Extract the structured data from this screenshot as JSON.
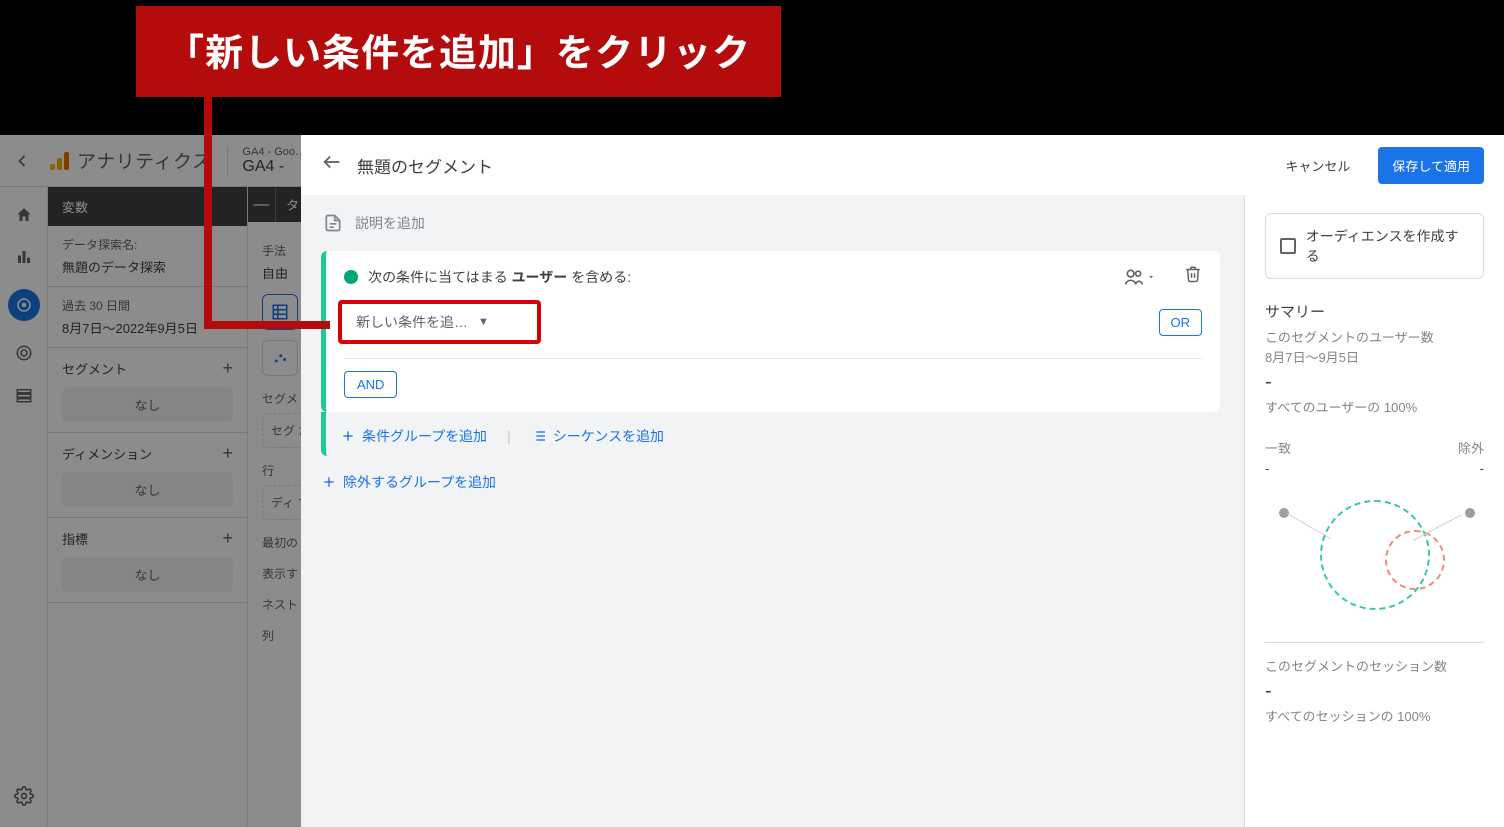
{
  "callout": "「新しい条件を追加」をクリック",
  "brand": "アナリティクス",
  "breadcrumb": {
    "l1": "GA4 - Goo…",
    "l2": "GA4 -"
  },
  "vars": {
    "header": "変数",
    "name_label": "データ探索名:",
    "name_value": "無題のデータ探索",
    "range_label": "過去 30 日間",
    "range_value": "8月7日～2022年9月5日",
    "segments": "セグメント",
    "dimensions": "ディメンション",
    "metrics": "指標",
    "none": "なし"
  },
  "tabs": {
    "header": "タブの",
    "method_label": "手法",
    "free": "自由",
    "segment_label": "セグメ",
    "seg_drop": "セグ\nた",
    "rows_label": "行",
    "row_drop": "ディ\nする",
    "first_label": "最初の",
    "show_label": "表示す",
    "nest_label": "ネスト",
    "col_label": "列"
  },
  "modal": {
    "title": "無題のセグメント",
    "cancel": "キャンセル",
    "apply": "保存して適用",
    "desc": "説明を追加",
    "include_prefix": "次の条件に当てはまる ",
    "include_bold": "ユーザー",
    "include_suffix": " を含める:",
    "add_cond": "新しい条件を追…",
    "or": "OR",
    "and": "AND",
    "add_group": "条件グループを追加",
    "add_seq": "シーケンスを追加",
    "add_exclude": "除外するグループを追加"
  },
  "summary": {
    "audience": "オーディエンスを作成する",
    "title": "サマリー",
    "users_label": "このセグメントのユーザー数",
    "range": "8月7日～9月5日",
    "all_users": "すべてのユーザーの 100%",
    "match": "一致",
    "exclude": "除外",
    "sessions_label": "このセグメントのセッション数",
    "all_sessions": "すべてのセッションの 100%"
  }
}
